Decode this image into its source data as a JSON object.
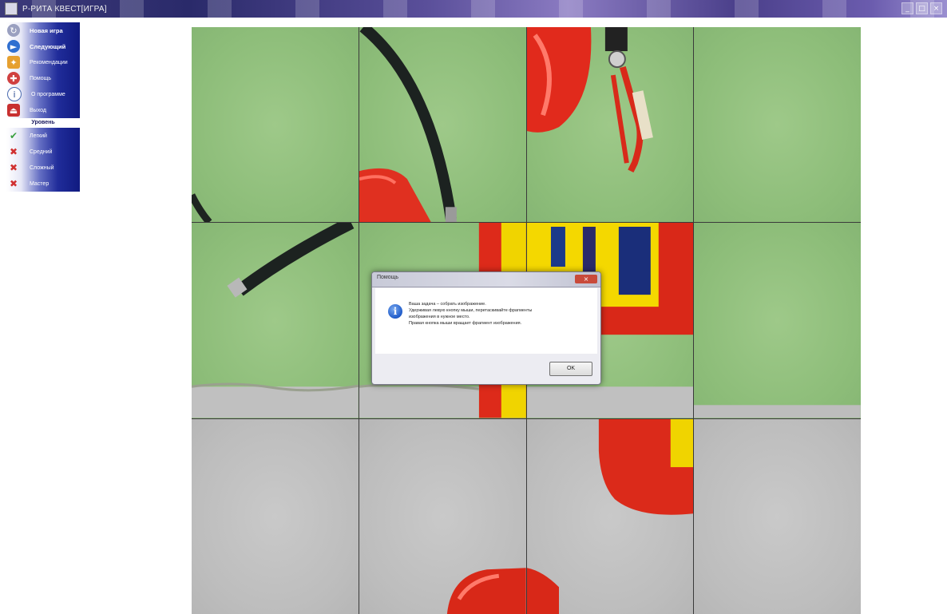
{
  "window": {
    "title": "Р-РИТА КВЕСТ[ИГРА]",
    "controls": [
      "_",
      "□",
      "×"
    ]
  },
  "sidebar": {
    "items_top": [
      {
        "label": "Новая игра",
        "icon": "refresh-icon",
        "bold": true
      },
      {
        "label": "Следующий",
        "icon": "next-arrow-icon",
        "bold": true
      },
      {
        "label": "Рекомендации",
        "icon": "puzzle-piece-icon",
        "bold": false
      },
      {
        "label": "Помощь",
        "icon": "lifebuoy-icon",
        "bold": false
      },
      {
        "label": "О программе",
        "icon": "info-icon",
        "bold": false
      },
      {
        "label": "Выход",
        "icon": "exit-icon",
        "bold": false
      }
    ],
    "section_header": "Уровень",
    "items_levels": [
      {
        "label": "Легкий",
        "icon": "check-icon"
      },
      {
        "label": "Средний",
        "icon": "cross-icon"
      },
      {
        "label": "Сложный",
        "icon": "cross-icon"
      },
      {
        "label": "Мастер",
        "icon": "cross-icon"
      }
    ]
  },
  "dialog": {
    "title": "Помощь",
    "close_label": "×",
    "lines": [
      "Ваша задача – собрать изображение.",
      "Удерживая левую кнопку мыши, перетаскивайте фрагменты",
      "изображения в нужное место.",
      "Правая кнопка мыши вращает фрагмент изображения."
    ],
    "ok_label": "OK",
    "icon": "info-icon"
  },
  "puzzle": {
    "rows": 3,
    "cols": 4
  }
}
